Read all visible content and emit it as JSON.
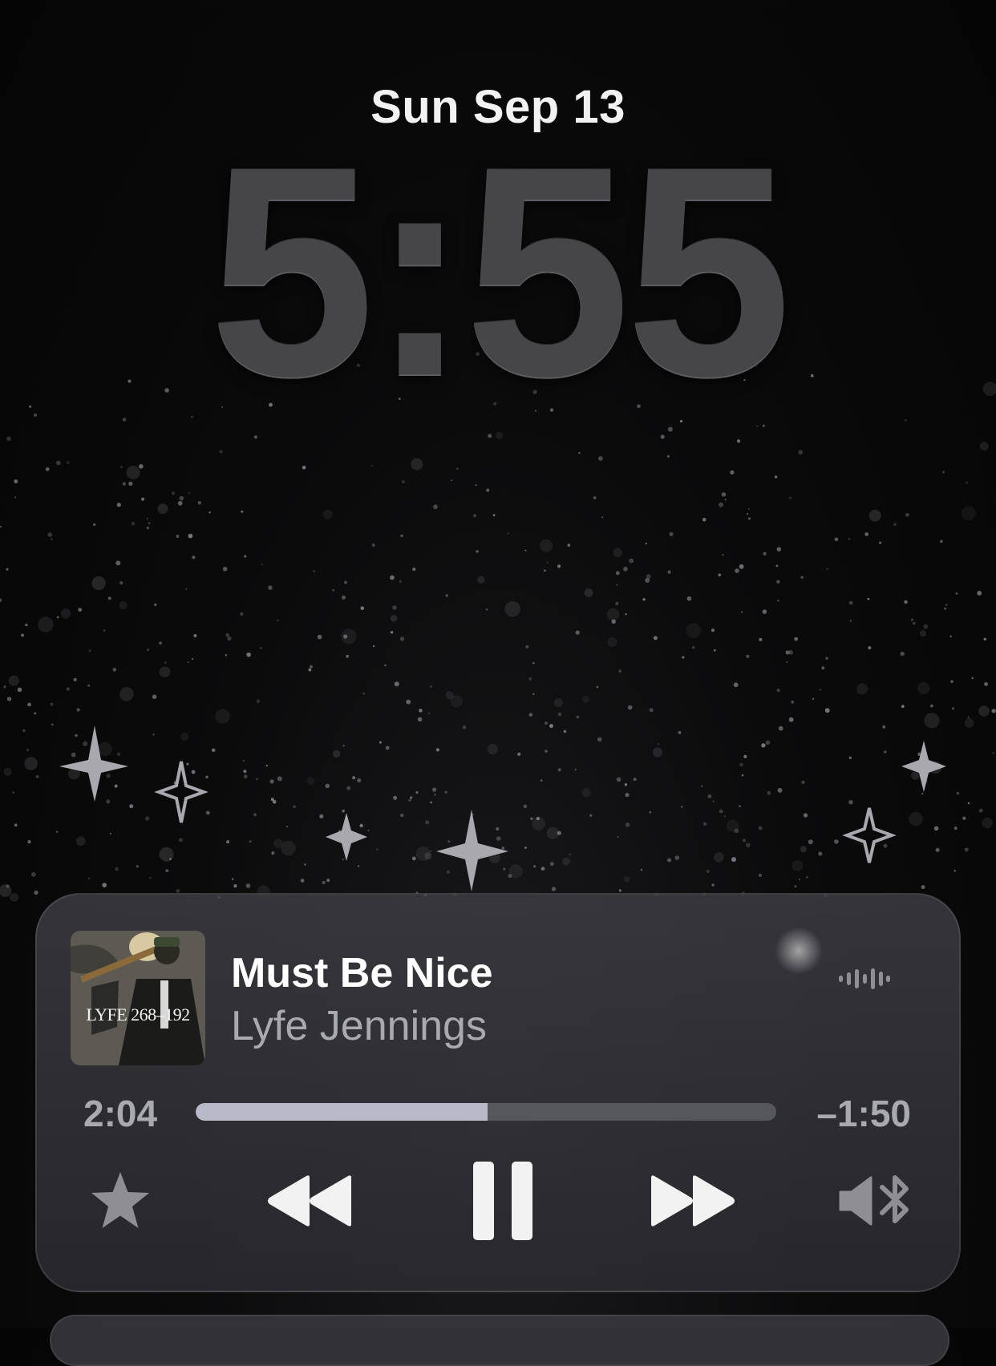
{
  "lock_screen": {
    "date": "Sun Sep 13",
    "time": "5:55"
  },
  "now_playing": {
    "title": "Must Be Nice",
    "artist": "Lyfe Jennings",
    "elapsed": "2:04",
    "remaining": "–1:50",
    "progress_fraction": 0.503,
    "artwork_text": "LYFE 268–192",
    "controls": {
      "favorite_icon": "star-icon",
      "previous_icon": "rewind-icon",
      "play_pause_icon": "pause-icon",
      "next_icon": "fast-forward-icon",
      "audio_route_icon": "speaker-bluetooth-icon",
      "waveform_icon": "audio-waveform-icon"
    }
  },
  "colors": {
    "clock": "#464649",
    "progress_fill": "#b9b9c7",
    "progress_track": "#56565d",
    "secondary_text": "#a9a9b0",
    "icon_white": "#f2f2f2",
    "star_gray": "#8e8e94"
  }
}
